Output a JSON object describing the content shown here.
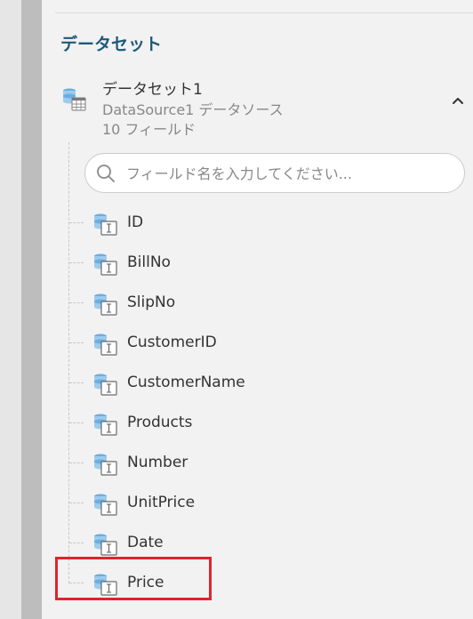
{
  "panel": {
    "section_title": "データセット"
  },
  "dataset": {
    "name": "データセット1",
    "source": "DataSource1 データソース",
    "field_count": "10 フィールド",
    "icon": "database-table-icon",
    "expanded": true
  },
  "search": {
    "placeholder": "フィールド名を入力してください...",
    "value": ""
  },
  "fields": [
    {
      "label": "ID",
      "icon": "text-field-icon"
    },
    {
      "label": "BillNo",
      "icon": "text-field-icon"
    },
    {
      "label": "SlipNo",
      "icon": "text-field-icon"
    },
    {
      "label": "CustomerID",
      "icon": "text-field-icon"
    },
    {
      "label": "CustomerName",
      "icon": "text-field-icon"
    },
    {
      "label": "Products",
      "icon": "text-field-icon"
    },
    {
      "label": "Number",
      "icon": "text-field-icon"
    },
    {
      "label": "UnitPrice",
      "icon": "text-field-icon"
    },
    {
      "label": "Date",
      "icon": "text-field-icon"
    },
    {
      "label": "Price",
      "icon": "text-field-icon",
      "highlighted": true
    }
  ],
  "colors": {
    "title": "#1e5a7a",
    "highlight": "#e0242a",
    "icon_blue": "#6aaee0",
    "background": "#f2f2f2",
    "sidebar_bar": "#bdbdbd"
  }
}
